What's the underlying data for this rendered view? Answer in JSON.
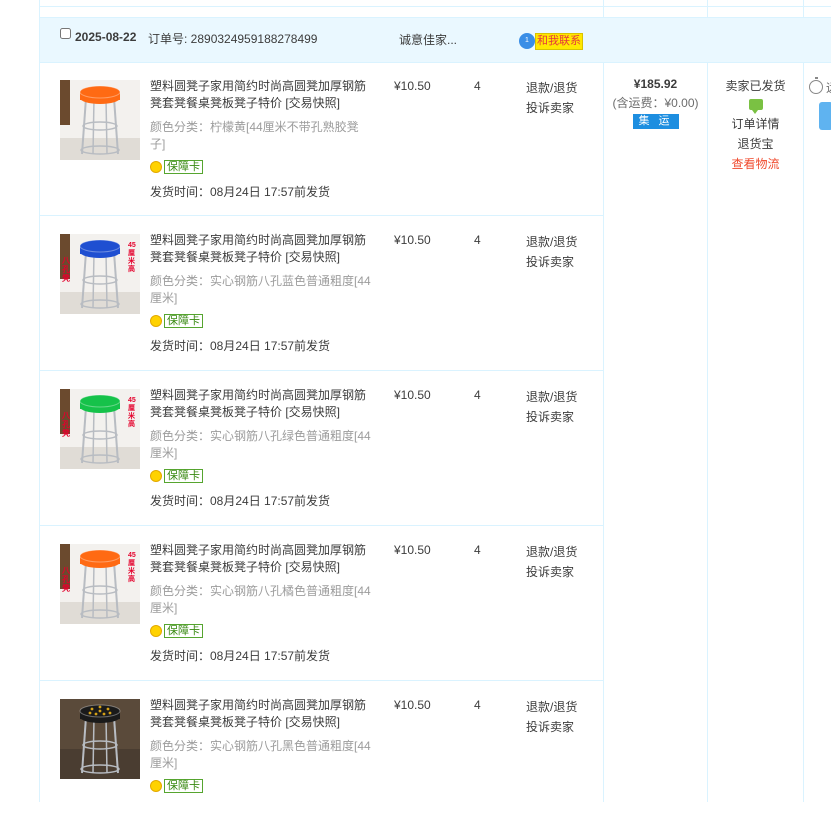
{
  "order": {
    "date": "2025-08-22",
    "order_no": "订单号: 2890324959188278499",
    "shop_name": "诚意佳家...",
    "contact_label": "和我联系",
    "contact_badge": "1",
    "total_amount": "¥185.92",
    "shipping_fee": "(含运费：¥0.00)",
    "shipping_tag": "集 运",
    "status": "卖家已发货",
    "details_link": "订单详情",
    "return_insurance": "退货宝",
    "logistics_link": "查看物流",
    "extra_truncated": "远"
  },
  "items": [
    {
      "title": "塑料圆凳子家用简约时尚高圆凳加厚钢筋凳套凳餐桌凳板凳子特价 [交易快照]",
      "sku": "颜色分类：柠檬黄[44厘米不带孔熟胶凳子]",
      "badge": "保障卡",
      "ship_time": "发货时间：08月24日 17:57前发货",
      "price": "¥10.50",
      "qty": "4",
      "refund": "退款/退货",
      "complain": "投诉卖家",
      "seat_color": "#ff6a13"
    },
    {
      "title": "塑料圆凳子家用简约时尚高圆凳加厚钢筋凳套凳餐桌凳板凳子特价 [交易快照]",
      "sku": "颜色分类：实心钢筋八孔蓝色普通粗度[44厘米]",
      "badge": "保障卡",
      "ship_time": "发货时间：08月24日 17:57前发货",
      "price": "¥10.50",
      "qty": "4",
      "refund": "退款/退货",
      "complain": "投诉卖家",
      "seat_color": "#1f4fd1",
      "img_text_left": "八孔凳",
      "img_text_right": "45厘米高"
    },
    {
      "title": "塑料圆凳子家用简约时尚高圆凳加厚钢筋凳套凳餐桌凳板凳子特价 [交易快照]",
      "sku": "颜色分类：实心钢筋八孔绿色普通粗度[44厘米]",
      "badge": "保障卡",
      "ship_time": "发货时间：08月24日 17:57前发货",
      "price": "¥10.50",
      "qty": "4",
      "refund": "退款/退货",
      "complain": "投诉卖家",
      "seat_color": "#16c24a",
      "img_text_left": "八孔凳",
      "img_text_right": "45厘米高"
    },
    {
      "title": "塑料圆凳子家用简约时尚高圆凳加厚钢筋凳套凳餐桌凳板凳子特价 [交易快照]",
      "sku": "颜色分类：实心钢筋八孔橘色普通粗度[44厘米]",
      "badge": "保障卡",
      "ship_time": "发货时间：08月24日 17:57前发货",
      "price": "¥10.50",
      "qty": "4",
      "refund": "退款/退货",
      "complain": "投诉卖家",
      "seat_color": "#ff6a13",
      "img_text_left": "八孔凳",
      "img_text_right": "45厘米高"
    },
    {
      "title": "塑料圆凳子家用简约时尚高圆凳加厚钢筋凳套凳餐桌凳板凳子特价 [交易快照]",
      "sku": "颜色分类：实心钢筋八孔黑色普通粗度[44厘米]",
      "badge": "保障卡",
      "ship_time": "",
      "price": "¥10.50",
      "qty": "4",
      "refund": "退款/退货",
      "complain": "投诉卖家",
      "seat_color": "#1a1a1a"
    }
  ]
}
